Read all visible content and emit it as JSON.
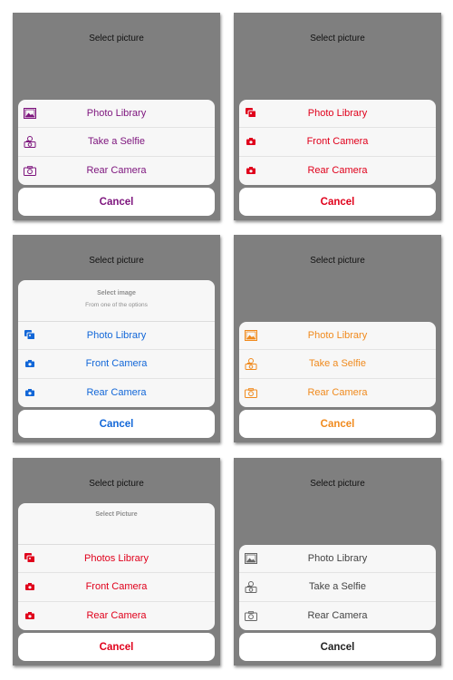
{
  "panels": [
    {
      "title": "Select picture",
      "colors": {
        "accent": "#7d147d"
      },
      "options": [
        {
          "label": "Photo Library",
          "icon": "photo-icon"
        },
        {
          "label": "Take a Selfie",
          "icon": "selfie-icon"
        },
        {
          "label": "Rear Camera",
          "icon": "camera-icon"
        }
      ],
      "cancel": "Cancel"
    },
    {
      "title": "Select picture",
      "colors": {
        "accent": "#e0001b"
      },
      "options": [
        {
          "label": "Photo Library",
          "icon": "photos-icon"
        },
        {
          "label": "Front Camera",
          "icon": "camera-icon"
        },
        {
          "label": "Rear Camera",
          "icon": "camera-icon"
        }
      ],
      "cancel": "Cancel"
    },
    {
      "title": "Select picture",
      "colors": {
        "accent": "#1267d8"
      },
      "header": {
        "title": "Select image",
        "subtitle": "From one of the options"
      },
      "options": [
        {
          "label": "Photo Library",
          "icon": "photos-icon"
        },
        {
          "label": "Front Camera",
          "icon": "camera-icon"
        },
        {
          "label": "Rear Camera",
          "icon": "camera-icon"
        }
      ],
      "cancel": "Cancel"
    },
    {
      "title": "Select picture",
      "colors": {
        "accent": "#f08a1d"
      },
      "options": [
        {
          "label": "Photo Library",
          "icon": "photo-icon"
        },
        {
          "label": "Take a Selfie",
          "icon": "selfie-icon"
        },
        {
          "label": "Rear Camera",
          "icon": "camera-icon"
        }
      ],
      "cancel": "Cancel"
    },
    {
      "title": "Select picture",
      "colors": {
        "accent": "#e0001b"
      },
      "header": {
        "title": "Select Picture"
      },
      "options": [
        {
          "label": "Photos Library",
          "icon": "photos-icon"
        },
        {
          "label": "Front Camera",
          "icon": "camera-icon"
        },
        {
          "label": "Rear Camera",
          "icon": "camera-icon"
        }
      ],
      "cancel": "Cancel"
    },
    {
      "title": "Select picture",
      "colors": {
        "accent": "#444444"
      },
      "options": [
        {
          "label": "Photo Library",
          "icon": "photo-icon"
        },
        {
          "label": "Take a Selfie",
          "icon": "selfie-icon"
        },
        {
          "label": "Rear Camera",
          "icon": "camera-icon"
        }
      ],
      "cancel": "Cancel"
    }
  ]
}
